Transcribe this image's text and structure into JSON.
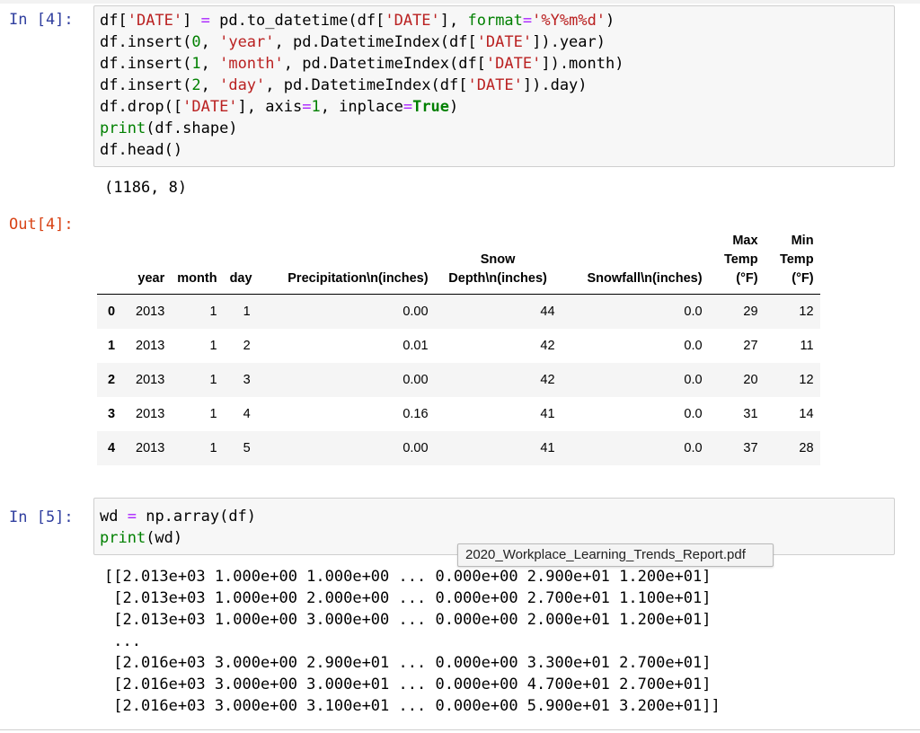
{
  "cell4": {
    "in_prompt": "In [4]:",
    "out_prompt": "Out[4]:",
    "stdout": "(1186, 8)"
  },
  "dataframe": {
    "columns": [
      "",
      "year",
      "month",
      "day",
      "Precipitation\\n(inches)",
      "Snow Depth\\n(inches)",
      "Snowfall\\n(inches)",
      "Max Temp (°F)",
      "Min Temp (°F)"
    ],
    "rows": [
      [
        "0",
        "2013",
        "1",
        "1",
        "0.00",
        "44",
        "0.0",
        "29",
        "12"
      ],
      [
        "1",
        "2013",
        "1",
        "2",
        "0.01",
        "42",
        "0.0",
        "27",
        "11"
      ],
      [
        "2",
        "2013",
        "1",
        "3",
        "0.00",
        "42",
        "0.0",
        "20",
        "12"
      ],
      [
        "3",
        "2013",
        "1",
        "4",
        "0.16",
        "41",
        "0.0",
        "31",
        "14"
      ],
      [
        "4",
        "2013",
        "1",
        "5",
        "0.00",
        "41",
        "0.0",
        "37",
        "28"
      ]
    ]
  },
  "cell5": {
    "in_prompt": "In [5]:",
    "stdout_lines": [
      "[[2.013e+03 1.000e+00 1.000e+00 ... 0.000e+00 2.900e+01 1.200e+01]",
      " [2.013e+03 1.000e+00 2.000e+00 ... 0.000e+00 2.700e+01 1.100e+01]",
      " [2.013e+03 1.000e+00 3.000e+00 ... 0.000e+00 2.000e+01 1.200e+01]",
      " ...",
      " [2.016e+03 3.000e+00 2.900e+01 ... 0.000e+00 3.300e+01 2.700e+01]",
      " [2.016e+03 3.000e+00 3.000e+01 ... 0.000e+00 4.700e+01 2.700e+01]",
      " [2.016e+03 3.000e+00 3.100e+01 ... 0.000e+00 5.900e+01 3.200e+01]]"
    ]
  },
  "tooltip": {
    "text": "2020_Workplace_Learning_Trends_Report.pdf"
  }
}
